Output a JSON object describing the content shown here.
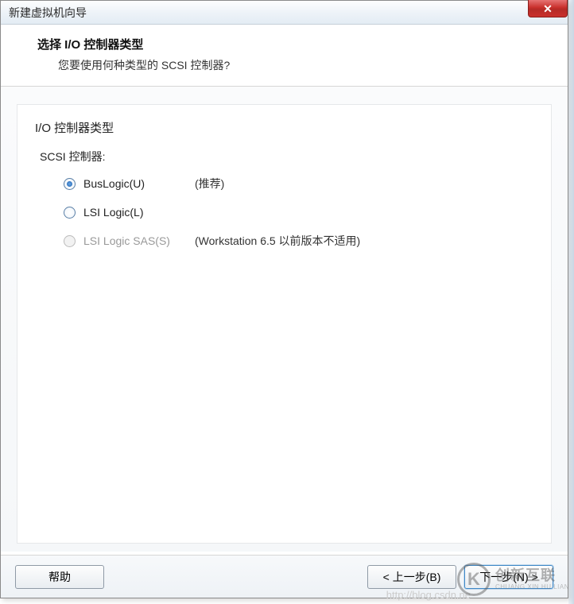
{
  "window": {
    "title": "新建虚拟机向导",
    "close_symbol": "✕"
  },
  "header": {
    "title": "选择 I/O 控制器类型",
    "subtitle": "您要使用何种类型的 SCSI 控制器?"
  },
  "content": {
    "section_title": "I/O 控制器类型",
    "group_label": "SCSI 控制器:",
    "options": [
      {
        "label": "BusLogic(U)",
        "extra": "(推荐)",
        "selected": true,
        "disabled": false
      },
      {
        "label": "LSI Logic(L)",
        "extra": "",
        "selected": false,
        "disabled": false
      },
      {
        "label": "LSI Logic SAS(S)",
        "extra": "(Workstation 6.5 以前版本不适用)",
        "selected": false,
        "disabled": true
      }
    ]
  },
  "footer": {
    "help": "帮助",
    "back": "< 上一步(B)",
    "next": "下一步(N) >"
  },
  "watermark": {
    "logo_letter": "K",
    "cn": "创新互联",
    "en": "CHUANG XIN HU LIAN",
    "url": "http://blog.csdn.ne"
  }
}
